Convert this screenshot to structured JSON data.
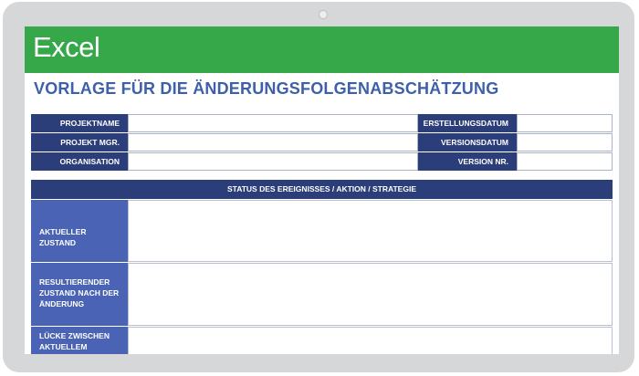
{
  "app": {
    "name": "Excel"
  },
  "document": {
    "title": "VORLAGE FÜR DIE ÄNDERUNGSFOLGENABSCHÄTZUNG"
  },
  "project_info": {
    "projektname": {
      "label": "PROJEKTNAME",
      "value": ""
    },
    "projekt_mgr": {
      "label": "PROJEKT MGR.",
      "value": ""
    },
    "organisation": {
      "label": "ORGANISATION",
      "value": ""
    },
    "erstellungsdatum": {
      "label": "ERSTELLUNGSDATUM",
      "value": ""
    },
    "versionsdatum": {
      "label": "VERSIONSDATUM",
      "value": ""
    },
    "version_nr": {
      "label": "VERSION NR.",
      "value": ""
    }
  },
  "status_section": {
    "header": "STATUS DES EREIGNISSES / AKTION / STRATEGIE",
    "rows": [
      {
        "label": "AKTUELLER ZUSTAND",
        "value": ""
      },
      {
        "label": "RESULTIERENDER ZUSTAND NACH DER ÄNDERUNG",
        "value": ""
      },
      {
        "label": "LÜCKE ZWISCHEN AKTUELLEM ZUSTAND",
        "value": ""
      }
    ]
  }
}
